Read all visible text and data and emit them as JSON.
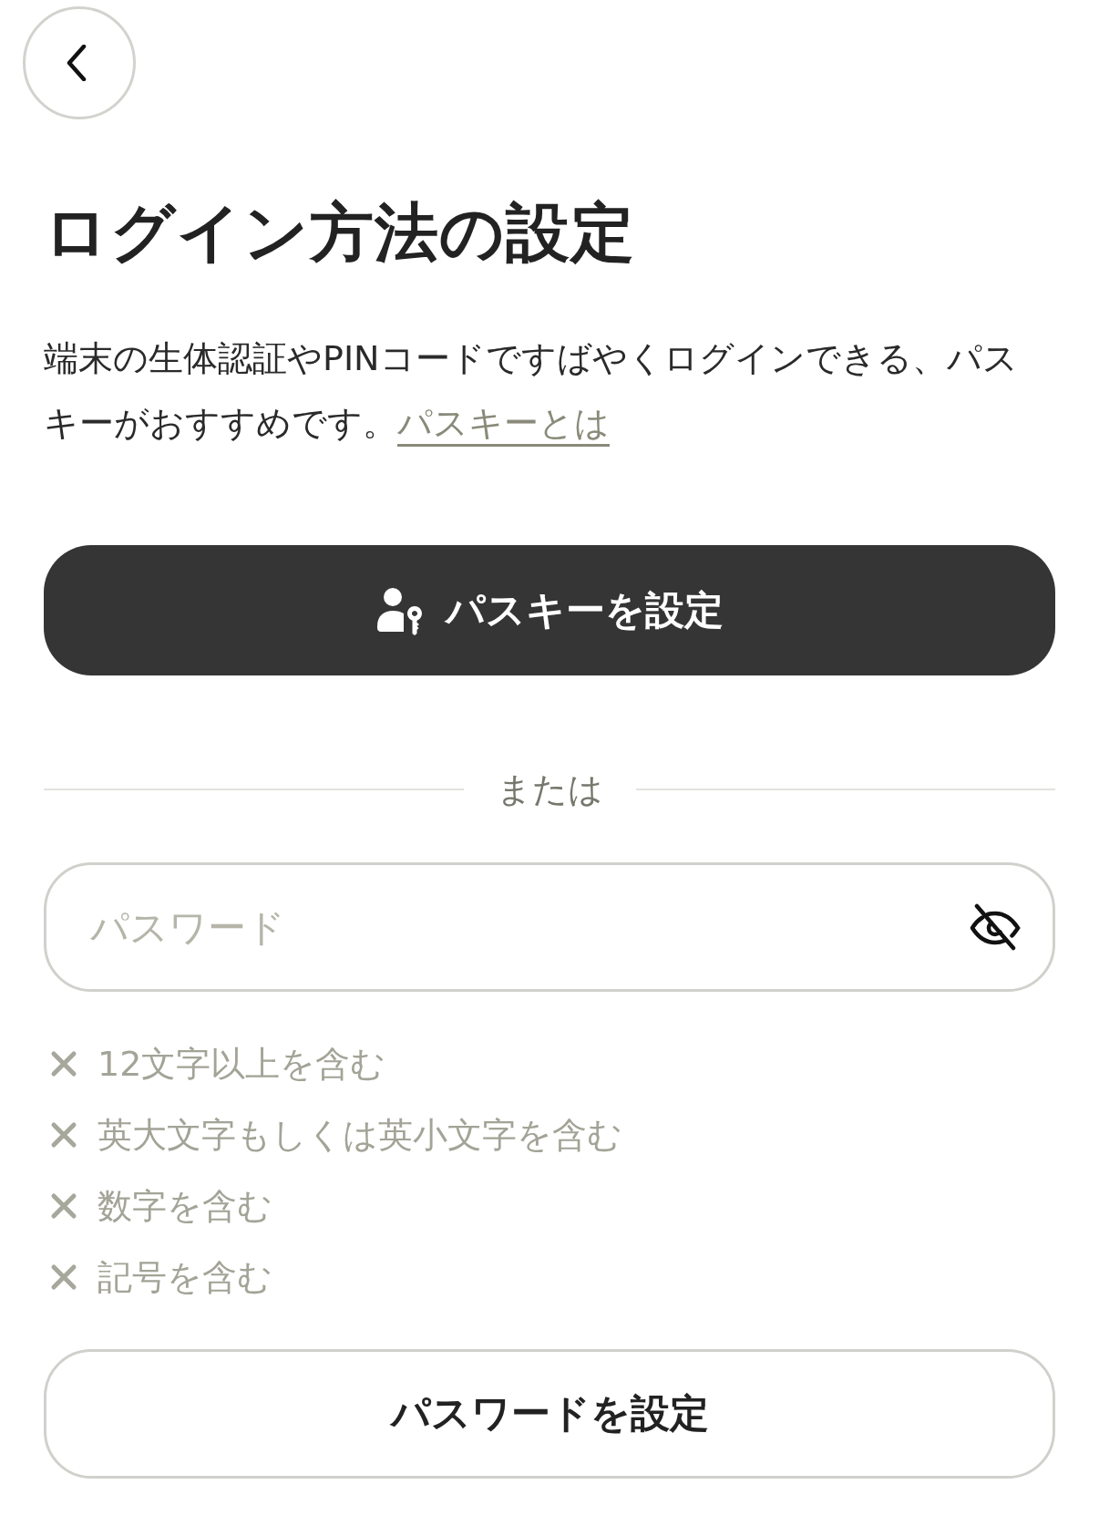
{
  "title": "ログイン方法の設定",
  "description": {
    "text": "端末の生体認証やPINコードですばやくログインできる、パスキーがおすすめです。",
    "link": "パスキーとは"
  },
  "passkey_button": {
    "label": "パスキーを設定"
  },
  "divider": {
    "label": "または"
  },
  "password_field": {
    "placeholder": "パスワード",
    "revealed": false
  },
  "requirements": [
    {
      "label": "12文字以上を含む",
      "met": false
    },
    {
      "label": "英大文字もしくは英小文字を含む",
      "met": false
    },
    {
      "label": "数字を含む",
      "met": false
    },
    {
      "label": "記号を含む",
      "met": false
    }
  ],
  "password_button": {
    "label": "パスワードを設定"
  }
}
